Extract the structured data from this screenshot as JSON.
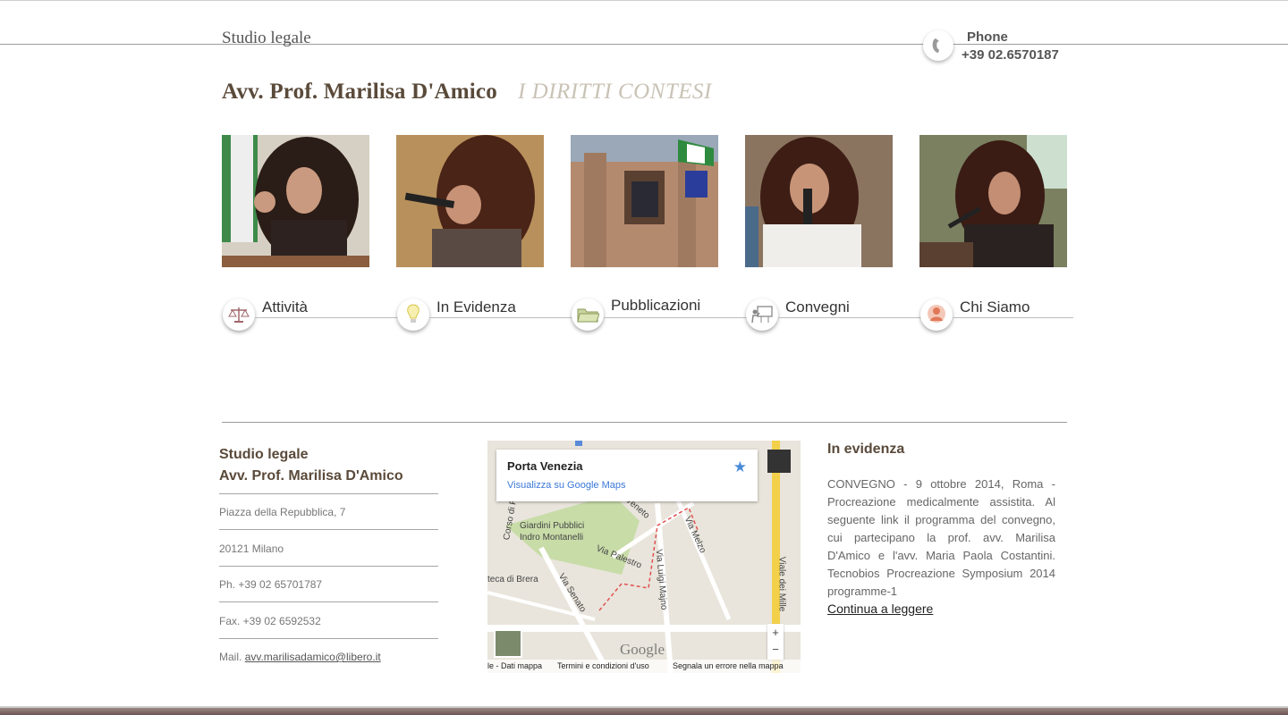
{
  "header": {
    "brand": "Studio legale",
    "phone_label": "Phone",
    "phone_number": "+39 02.6570187",
    "title": "Avv. Prof. Marilisa D'Amico",
    "subtitle": "I DIRITTI CONTESI"
  },
  "nav": [
    {
      "label": "Attività",
      "icon": "scales-icon"
    },
    {
      "label": "In Evidenza",
      "icon": "lightbulb-icon"
    },
    {
      "label": "Pubblicazioni",
      "icon": "folder-icon"
    },
    {
      "label": "Convegni",
      "icon": "presentation-icon"
    },
    {
      "label": "Chi Siamo",
      "icon": "person-icon"
    }
  ],
  "contact": {
    "title_line1": "Studio legale",
    "title_line2": "Avv. Prof. Marilisa D'Amico",
    "address": "Piazza della Repubblica, 7",
    "city": "20121 Milano",
    "phone": "Ph. +39 02 65701787",
    "fax": "Fax. +39 02 6592532",
    "mail_label": "Mail.",
    "mail": "avv.marilisadamico@libero.it"
  },
  "map": {
    "place": "Porta Venezia",
    "link": "Visualizza su Google Maps",
    "logo": "Google",
    "footer_data": "le - Dati mappa",
    "footer_terms": "Termini e condizioni d'uso",
    "footer_report": "Segnala un errore nella mappa",
    "zoom_in": "+",
    "zoom_out": "−",
    "labels": [
      "Giardini Pubblici",
      "Indro Montanelli",
      "Via Palestro",
      "teca di Brera",
      "Via Senato",
      "Via Luigi Majno",
      "Viale dei Mille",
      "Corso di Po",
      "Via Melzo",
      "Veneto"
    ]
  },
  "evidenza": {
    "title": "In evidenza",
    "text": "CONVEGNO - 9 ottobre 2014, Roma - Procreazione medicalmente assistita. Al seguente link il programma del convegno, cui partecipano la prof. avv. Marilisa D'Amico e l'avv. Maria Paola Costantini. Tecnobios Procreazione Symposium 2014 programme-1",
    "link": "Continua a leggere"
  },
  "colors": {
    "title": "#5a4a3a",
    "subtitle": "#c9c3b6",
    "link_blue": "#3b78d8"
  }
}
